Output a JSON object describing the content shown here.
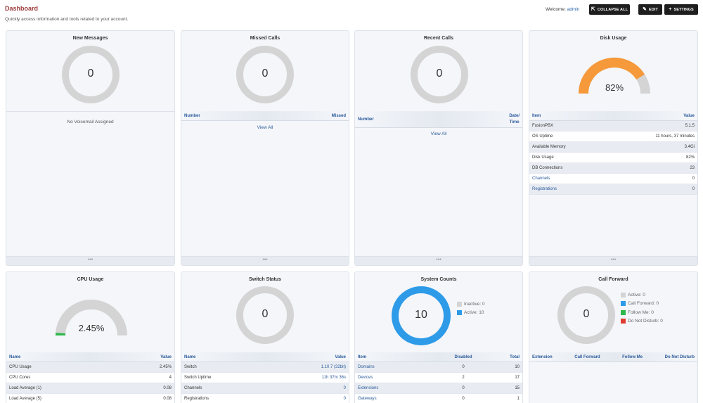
{
  "header": {
    "title": "Dashboard",
    "subtitle": "Quickly access information and tools related to your account.",
    "welcome_label": "Welcome:",
    "username": "admin",
    "collapse_label": "COLLAPSE ALL",
    "edit_label": "EDIT",
    "settings_label": "SETTINGS"
  },
  "new_messages": {
    "title": "New Messages",
    "count": "0",
    "note": "No Voicemail Assigned",
    "foot": "•••"
  },
  "missed_calls": {
    "title": "Missed Calls",
    "count": "0",
    "col_number": "Number",
    "col_missed": "Missed",
    "view_all": "View All",
    "foot": "•••"
  },
  "recent_calls": {
    "title": "Recent Calls",
    "count": "0",
    "col_number": "Number",
    "col_date": "Date/",
    "col_time": "Time",
    "view_all": "View All",
    "foot": "•••"
  },
  "disk_usage": {
    "title": "Disk Usage",
    "percent": 82,
    "value_text": "82%",
    "col_item": "Item",
    "col_value": "Value",
    "rows": [
      {
        "item": "FusionPBX",
        "value": "5.1.5"
      },
      {
        "item": "OS Uptime",
        "value": "11 hours, 37 minutes"
      },
      {
        "item": "Available Memory",
        "value": "3.4Gi"
      },
      {
        "item": "Disk Usage",
        "value": "82%"
      },
      {
        "item": "DB Connections",
        "value": "23"
      },
      {
        "item": "Channels",
        "value": "0"
      },
      {
        "item": "Registrations",
        "value": "0"
      }
    ],
    "foot": "•••",
    "colors": {
      "fill": "#f5993a",
      "track": "#d4d4d4"
    }
  },
  "cpu_usage": {
    "title": "CPU Usage",
    "percent": 2.45,
    "value_text": "2.45%",
    "col_name": "Name",
    "col_value": "Value",
    "rows": [
      {
        "name": "CPU Usage",
        "value": "2.45%"
      },
      {
        "name": "CPU Cores",
        "value": "4"
      },
      {
        "name": "Load Average (1)",
        "value": "0.08"
      },
      {
        "name": "Load Average (5)",
        "value": "0.08"
      }
    ],
    "colors": {
      "fill": "#2eb84b",
      "track": "#d4d4d4"
    }
  },
  "switch_status": {
    "title": "Switch Status",
    "count": "0",
    "col_name": "Name",
    "col_value": "Value",
    "rows": [
      {
        "name": "Switch",
        "value": "1.10.7 (32bit)"
      },
      {
        "name": "Switch Uptime",
        "value": "11h 37m 36s"
      },
      {
        "name": "Channels",
        "value": "0"
      },
      {
        "name": "Registrations",
        "value": "0"
      }
    ]
  },
  "system_counts": {
    "title": "System Counts",
    "count": "10",
    "legend": [
      {
        "label": "Inactive: 0",
        "color": "#d4d4d4"
      },
      {
        "label": "Active: 10",
        "color": "#2d9be8"
      }
    ],
    "col_item": "Item",
    "col_disabled": "Disabled",
    "col_total": "Total",
    "rows": [
      {
        "item": "Domains",
        "disabled": "0",
        "total": "10"
      },
      {
        "item": "Devices",
        "disabled": "2",
        "total": "17"
      },
      {
        "item": "Extensions",
        "disabled": "0",
        "total": "15"
      },
      {
        "item": "Gateways",
        "disabled": "0",
        "total": "1"
      }
    ],
    "ring_color": "#2d9be8"
  },
  "call_forward": {
    "title": "Call Forward",
    "count": "0",
    "legend": [
      {
        "label": "Active: 0",
        "color": "#d4d4d4"
      },
      {
        "label": "Call Forward: 0",
        "color": "#2d9be8"
      },
      {
        "label": "Follow Me: 0",
        "color": "#2eb84b"
      },
      {
        "label": "Do Not Disturb: 0",
        "color": "#e03c31"
      }
    ],
    "col_extension": "Extension",
    "col_call_forward": "Call Forward",
    "col_follow_me": "Follow Me",
    "col_dnd": "Do Not Disturb"
  },
  "ring_track_color": "#d4d4d4"
}
